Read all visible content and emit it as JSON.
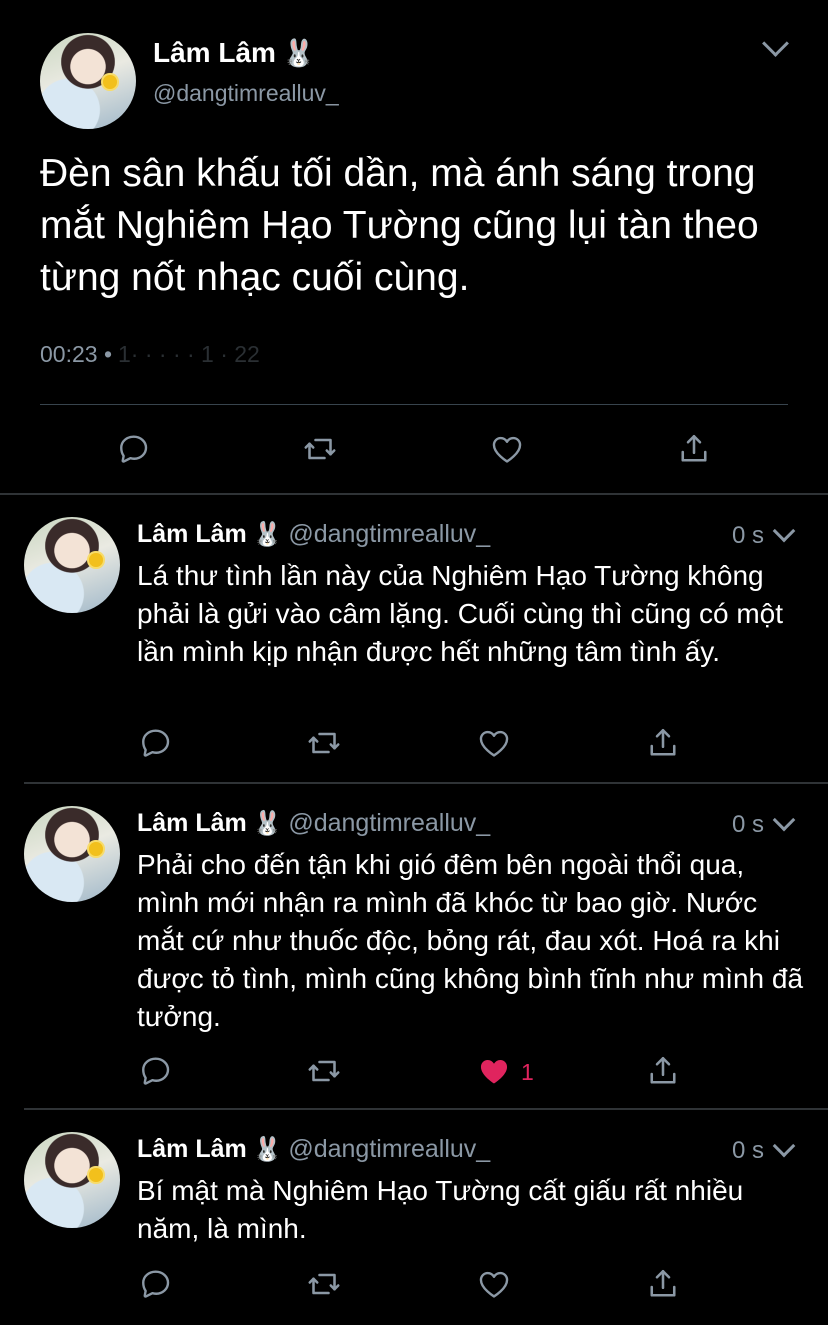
{
  "main_tweet": {
    "name": "Lâm Lâm",
    "name_emoji": "🐰",
    "handle": "@dangtimrealluv_",
    "text": "Đèn sân khấu tối dần, mà ánh sáng trong mắt Nghiêm Hạo Tường cũng lụi tàn theo từng nốt nhạc cuối cùng.",
    "time": "00:23 •",
    "date_obscured": "1· · · · · 1 · 22"
  },
  "replies": [
    {
      "name": "Lâm Lâm",
      "name_emoji": "🐰",
      "handle": "@dangtimrealluv_",
      "time": "0 s",
      "text": "Lá thư tình lần này của Nghiêm Hạo Tường không phải là gửi vào câm lặng. Cuối cùng thì cũng có một lần mình kịp nhận được hết những tâm tình ấy.",
      "likes": ""
    },
    {
      "name": "Lâm Lâm",
      "name_emoji": "🐰",
      "handle": "@dangtimrealluv_",
      "time": "0 s",
      "text": "Phải cho đến tận khi gió đêm bên ngoài thổi qua, mình mới nhận ra mình đã khóc từ bao giờ. Nước mắt cứ như thuốc độc, bỏng rát, đau xót. Hoá ra khi được tỏ tình, mình cũng không bình tĩnh như mình đã tưởng.",
      "likes": "1"
    },
    {
      "name": "Lâm Lâm",
      "name_emoji": "🐰",
      "handle": "@dangtimrealluv_",
      "time": "0 s",
      "text": "Bí mật mà Nghiêm Hạo Tường cất giấu rất nhiều năm, là mình.",
      "likes": ""
    }
  ],
  "colors": {
    "background": "#000000",
    "secondary_text": "#8b98a5",
    "like_active": "#e0245e",
    "divider": "#2f3336"
  },
  "icons": [
    "reply-icon",
    "retweet-icon",
    "like-icon",
    "share-icon",
    "chevron-down-icon"
  ]
}
